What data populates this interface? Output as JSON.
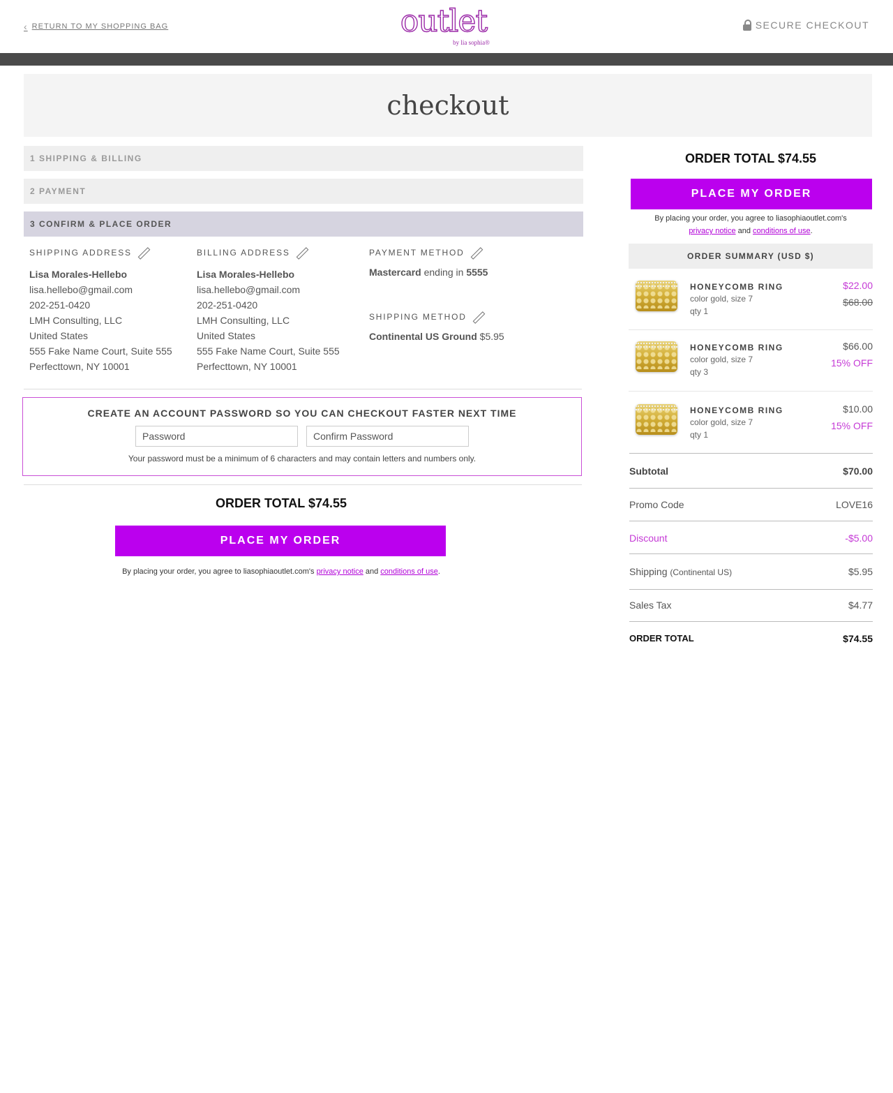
{
  "header": {
    "back_link": "RETURN TO MY SHOPPING BAG",
    "logo_word": "outlet",
    "logo_byline": "by lia sophia®",
    "secure": "SECURE CHECKOUT"
  },
  "page_title": "checkout",
  "steps": [
    {
      "label": "1 SHIPPING & BILLING"
    },
    {
      "label": "2 PAYMENT"
    },
    {
      "label": "3 CONFIRM & PLACE ORDER"
    }
  ],
  "shipping_address": {
    "heading": "SHIPPING ADDRESS",
    "name": "Lisa Morales-Hellebo",
    "email": "lisa.hellebo@gmail.com",
    "phone": "202-251-0420",
    "company": "LMH Consulting, LLC",
    "country": "United States",
    "street": "555 Fake Name Court, Suite 555",
    "city": "Perfecttown, NY 10001"
  },
  "billing_address": {
    "heading": "BILLING ADDRESS",
    "name": "Lisa Morales-Hellebo",
    "email": "lisa.hellebo@gmail.com",
    "phone": "202-251-0420",
    "company": "LMH Consulting, LLC",
    "country": "United States",
    "street": "555 Fake Name Court, Suite 555",
    "city": "Perfecttown, NY 10001"
  },
  "payment_method": {
    "heading": "PAYMENT METHOD",
    "card": "Mastercard",
    "ending_text": " ending in ",
    "last4": "5555"
  },
  "shipping_method": {
    "heading": "SHIPPING METHOD",
    "method": "Continental US Ground",
    "price": " $5.95"
  },
  "account": {
    "title": "CREATE AN ACCOUNT PASSWORD SO YOU CAN CHECKOUT FASTER NEXT TIME",
    "password_placeholder": "Password",
    "confirm_placeholder": "Confirm Password",
    "note": "Your password must be a minimum of 6 characters and may contain letters and numbers only."
  },
  "order_total_label": "ORDER TOTAL $74.55",
  "place_order_label": "PLACE MY ORDER",
  "agree": {
    "prefix": "By placing your order, you agree to liasophiaoutlet.com's ",
    "privacy": "privacy notice",
    "and": " and ",
    "conditions": "conditions of use",
    "suffix": "."
  },
  "summary": {
    "heading": "ORDER SUMMARY (USD $)",
    "items": [
      {
        "name": "HONEYCOMB RING",
        "variant": "color gold, size 7",
        "qty": "qty 1",
        "price": "$22.00",
        "secondary": "$68.00"
      },
      {
        "name": "HONEYCOMB RING",
        "variant": "color gold, size 7",
        "qty": "qty 3",
        "price": "$66.00",
        "secondary": "15% OFF"
      },
      {
        "name": "HONEYCOMB RING",
        "variant": "color gold, size 7",
        "qty": "qty 1",
        "price": "$10.00",
        "secondary": "15% OFF"
      }
    ],
    "subtotal_label": "Subtotal",
    "subtotal": "$70.00",
    "promo_label": "Promo Code",
    "promo": "LOVE16",
    "discount_label": "Discount",
    "discount": "-$5.00",
    "shipping_label": "Shipping",
    "shipping_note": "(Continental US)",
    "shipping": "$5.95",
    "tax_label": "Sales Tax",
    "tax": "$4.77",
    "total_label": "ORDER TOTAL",
    "total": "$74.55"
  },
  "colors": {
    "accent": "#bb00ee",
    "brand": "#9b2aa8",
    "active_step": "#d6d4e0"
  }
}
